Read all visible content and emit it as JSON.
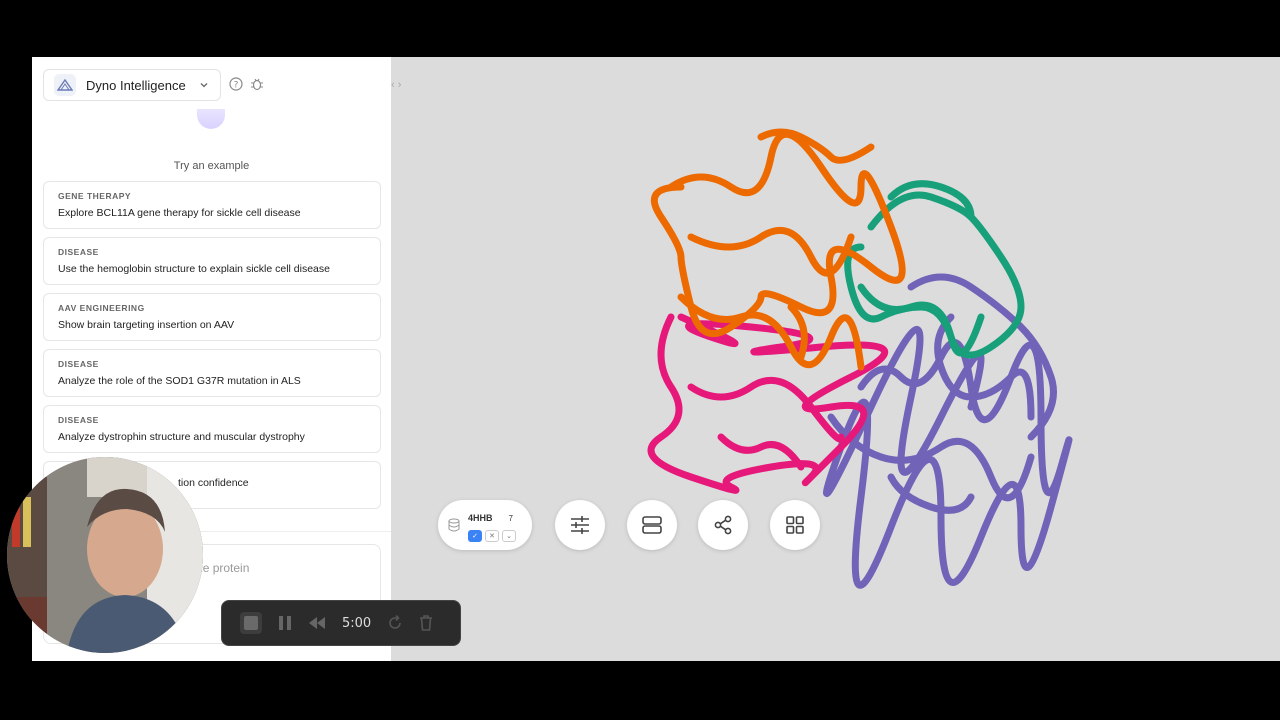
{
  "header": {
    "model_name": "Dyno Intelligence"
  },
  "sidebar": {
    "try_example": "Try an example",
    "examples": [
      {
        "category": "GENE THERAPY",
        "text": "Explore BCL11A gene therapy for sickle cell disease"
      },
      {
        "category": "DISEASE",
        "text": "Use the hemoglobin structure to explain sickle cell disease"
      },
      {
        "category": "AAV ENGINEERING",
        "text": "Show brain targeting insertion on AAV"
      },
      {
        "category": "DISEASE",
        "text": "Analyze the role of the SOD1 G37R mutation in ALS"
      },
      {
        "category": "DISEASE",
        "text": "Analyze dystrophin structure and muscular dystrophy"
      },
      {
        "category": "",
        "text": "tion confidence"
      }
    ],
    "input_placeholder_visible": "or analyze protein"
  },
  "viewer": {
    "pdb_id": "4HHB",
    "chain_count": "7",
    "chain_colors": [
      "#ec6a00",
      "#17a07a",
      "#e6197a",
      "#7163b8"
    ]
  },
  "recorder": {
    "time": "5:00"
  },
  "icons": [
    "model-icon",
    "chevron-down-icon",
    "help-icon",
    "bug-icon",
    "database-icon",
    "sliders-icon",
    "server-icon",
    "share-icon",
    "grid-icon",
    "stop-icon",
    "pause-icon",
    "rewind-icon",
    "restart-icon",
    "trash-icon"
  ]
}
